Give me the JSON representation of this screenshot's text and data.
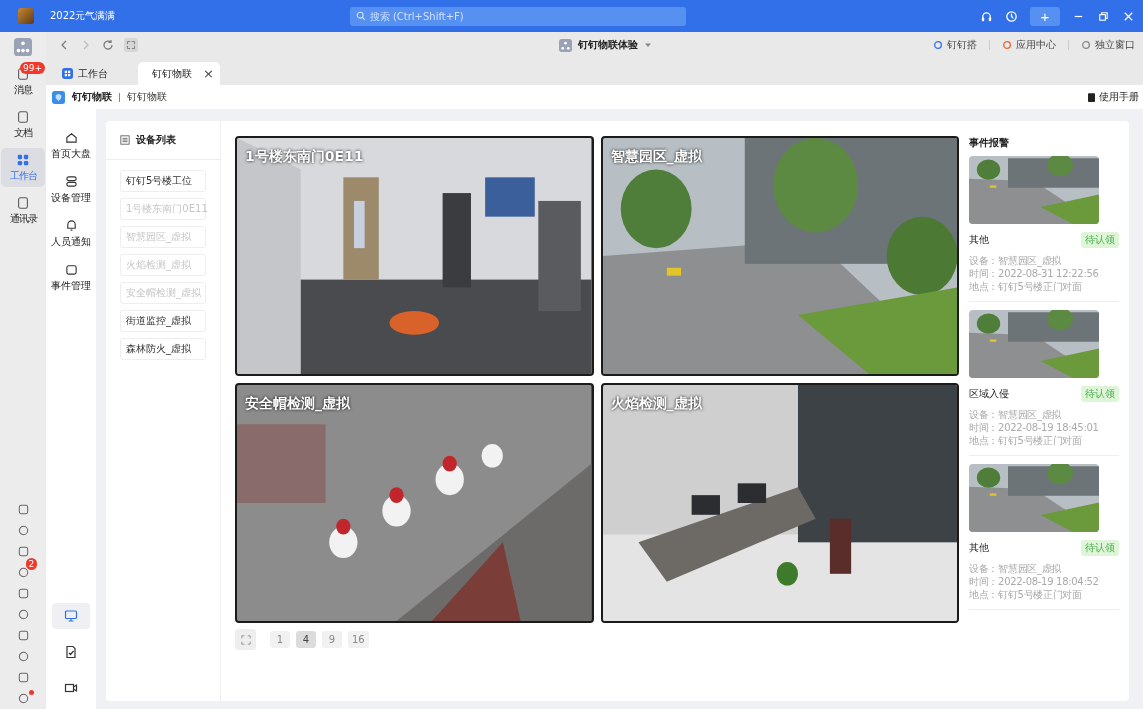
{
  "title_bar": {
    "status": "2022元气满满",
    "search": {
      "placeholder": "搜索 (Ctrl+Shift+F)"
    },
    "plus": "+"
  },
  "rail": {
    "items": [
      {
        "label": "消息",
        "selected": false,
        "badge": "99+"
      },
      {
        "label": "文档",
        "selected": false
      },
      {
        "label": "工作台",
        "selected": true
      },
      {
        "label": "通讯录",
        "selected": false
      }
    ],
    "tools": [
      {
        "dot": false
      },
      {
        "dot": false
      },
      {
        "dot": false
      },
      {
        "dot": false,
        "badge": "2"
      },
      {
        "dot": false
      },
      {
        "dot": false
      },
      {
        "dot": false
      },
      {
        "dot": false
      },
      {
        "dot": false
      },
      {
        "dot": true
      }
    ]
  },
  "toolbar": {
    "title": "钉钉物联体验",
    "links": [
      "钉钉搭",
      "应用中心",
      "独立窗口"
    ]
  },
  "tabs": [
    {
      "label": "工作台",
      "selected": false
    },
    {
      "label": "钉钉物联",
      "selected": true,
      "close": "×"
    }
  ],
  "app_header": {
    "name": "钉钉物联",
    "crumb": "钉钉物联",
    "manual": "使用手册"
  },
  "nav": {
    "items": [
      "首页大盘",
      "设备管理",
      "人员通知",
      "事件管理"
    ],
    "tools": [
      {
        "selected": true
      },
      {
        "selected": false
      },
      {
        "selected": false
      }
    ]
  },
  "device_list": {
    "title": "设备列表",
    "items": [
      {
        "name": "钉钉5号楼工位",
        "online": true
      },
      {
        "name": "1号楼东南门0E11",
        "online": false
      },
      {
        "name": "智慧园区_虚拟",
        "online": false
      },
      {
        "name": "火焰检测_虚拟",
        "online": false
      },
      {
        "name": "安全帽检测_虚拟",
        "online": false
      },
      {
        "name": "街道监控_虚拟",
        "online": true
      },
      {
        "name": "森林防火_虚拟",
        "online": true
      }
    ]
  },
  "cameras": [
    {
      "title": "1号楼东南门0E11"
    },
    {
      "title": "智慧园区_虚拟"
    },
    {
      "title": "安全帽检测_虚拟"
    },
    {
      "title": "火焰检测_虚拟"
    }
  ],
  "pagination": [
    {
      "label": "1",
      "selected": false
    },
    {
      "label": "4",
      "selected": true
    },
    {
      "label": "9",
      "selected": false
    },
    {
      "label": "16",
      "selected": false
    }
  ],
  "events": {
    "title": "事件报警",
    "items": [
      {
        "type": "其他",
        "status": "待认领",
        "device": "设备：智慧园区_虚拟",
        "time": "时间：2022-08-31 12:22:56",
        "place": "地点：钉钉5号楼正门对面"
      },
      {
        "type": "区域入侵",
        "status": "待认领",
        "device": "设备：智慧园区_虚拟",
        "time": "时间：2022-08-19 18:45:01",
        "place": "地点：钉钉5号楼正门对面"
      },
      {
        "type": "其他",
        "status": "待认领",
        "device": "设备：智慧园区_虚拟",
        "time": "时间：2022-08-19 18:04:52",
        "place": "地点：钉钉5号楼正门对面"
      }
    ]
  }
}
